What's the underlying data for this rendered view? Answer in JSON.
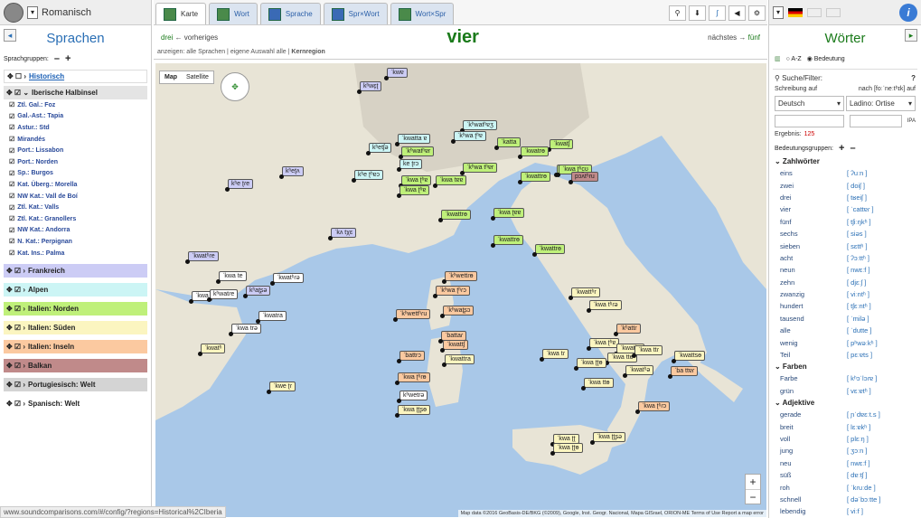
{
  "left_panel": {
    "app_name": "Romanisch",
    "title": "Sprachen",
    "groups_label": "Sprachgruppen:",
    "groups": [
      {
        "label": "Historisch",
        "color": "#ffffff",
        "expanded": false
      },
      {
        "label": "Iberische Halbinsel",
        "color": "#e4e4e4",
        "expanded": true
      }
    ],
    "iberian_languages": [
      "Ztl. Gal.: Foz",
      "Gal.-Ast.: Tapia",
      "Astur.: Std",
      "Mirandés",
      "Port.: Lissabon",
      "Port.: Norden",
      "Sp.: Burgos",
      "Kat. Überg.: Morella",
      "NW Kat.: Vall de Boí",
      "Ztl. Kat.: Valls",
      "Ztl. Kat.: Granollers",
      "NW Kat.: Andorra",
      "N. Kat.: Perpignan",
      "Kat. Ins.: Palma"
    ],
    "other_groups": [
      {
        "label": "Frankreich",
        "color": "#ccccf5"
      },
      {
        "label": "Alpen",
        "color": "#ccf5f5"
      },
      {
        "label": "Italien: Norden",
        "color": "#bff07a"
      },
      {
        "label": "Italien: Süden",
        "color": "#fbf5c0"
      },
      {
        "label": "Italien: Inseln",
        "color": "#fbc9a0"
      },
      {
        "label": "Balkan",
        "color": "#c08a8a"
      },
      {
        "label": "Portugiesisch: Welt",
        "color": "#d4d4d4"
      },
      {
        "label": "Spanisch: Welt",
        "color": "#ffffff"
      }
    ]
  },
  "center": {
    "tabs": [
      "Karte",
      "Wort",
      "Sprache",
      "Spr×Wort",
      "Wort×Spr"
    ],
    "prev_word": "drei",
    "prev_label": "vorheriges",
    "current_word": "vier",
    "next_label": "nächstes",
    "next_word": "fünf",
    "show_text": "anzeigen: alle Sprachen | eigene Auswahl    alle | ",
    "show_bold": "Kernregion",
    "map_types": [
      "Map",
      "Satellite"
    ],
    "map_attribution": "Map data ©2016 GeoBasis-DE/BKG (©2009), Google, Inst. Geogr. Nacional, Mapa GISrael, ORION-ME   Terms of Use   Report a map error",
    "map_labels": [
      {
        "text": "ˈkwɐ",
        "bg": "#ccccf5"
      },
      {
        "text": "kʰwɛ̞ʈ",
        "bg": "#ccccf5"
      },
      {
        "text": "ˈkʰwatʰɐʒ",
        "bg": "#ccf5f5"
      },
      {
        "text": "ˈkʰwa ʈʰɐ",
        "bg": "#ccf5f5"
      },
      {
        "text": "ˈkwatta ɐ",
        "bg": "#ccf5f5"
      },
      {
        "text": "ˈkʰwatʰɐr",
        "bg": "#bff07a"
      },
      {
        "text": "ˈkatta",
        "bg": "#bff07a"
      },
      {
        "text": "kʰetʃə",
        "bg": "#ccf5f5"
      },
      {
        "text": "ˈkwatʃ",
        "bg": "#bff07a"
      },
      {
        "text": "ˈkwatrɵ",
        "bg": "#bff07a"
      },
      {
        "text": "ke ʈrɔ",
        "bg": "#ccf5f5"
      },
      {
        "text": "ˈkʰwa tʰɐr",
        "bg": "#bff07a"
      },
      {
        "text": "kʰeʈʌ",
        "bg": "#ccccf5"
      },
      {
        "text": "kʰe ʈʰɐɔ",
        "bg": "#ccf5f5"
      },
      {
        "text": "ˈkwa ʈʰɐ",
        "bg": "#bff07a"
      },
      {
        "text": "ˈkwa tɐɐ",
        "bg": "#bff07a"
      },
      {
        "text": "kʰe ʈɾe",
        "bg": "#ccccf5"
      },
      {
        "text": "ˈkwa ʈʰɐ",
        "bg": "#bff07a"
      },
      {
        "text": "ˈkwattrɵ",
        "bg": "#bff07a"
      },
      {
        "text": "ˈkwatrɵ",
        "bg": "#bff07a"
      },
      {
        "text": "ˈkwa ʈʰcʊ",
        "bg": "#bff07a"
      },
      {
        "text": "pɔʌ̃tʰɾu",
        "bg": "#c08a8a"
      },
      {
        "text": "ˈkwattrɵ",
        "bg": "#bff07a"
      },
      {
        "text": "ˈkwa ʈɐɐ",
        "bg": "#bff07a"
      },
      {
        "text": "ˈkwattrɵ",
        "bg": "#bff07a"
      },
      {
        "text": "ˈkʌ tχɛ",
        "bg": "#ccccf5"
      },
      {
        "text": "ˈkwattrɵ",
        "bg": "#bff07a"
      },
      {
        "text": "ˈkwatʰɾe",
        "bg": "#ccccf5"
      },
      {
        "text": "ˈkwa te",
        "bg": "#ffffff"
      },
      {
        "text": "ˈkwatʰɾə",
        "bg": "#ffffff"
      },
      {
        "text": "ˈkwa",
        "bg": "#ffffff"
      },
      {
        "text": "kʰwatɾe",
        "bg": "#ffffff"
      },
      {
        "text": "kʰaʈʂə",
        "bg": "#ccccf5"
      },
      {
        "text": "ˈkʰwettɾɵ",
        "bg": "#fbc9a0"
      },
      {
        "text": "ˈkʰwa ʈʰɾɔ",
        "bg": "#fbc9a0"
      },
      {
        "text": "ˈkʰwettʰɾu",
        "bg": "#fbc9a0"
      },
      {
        "text": "ˈkʰwaʈʂɔ",
        "bg": "#fbc9a0"
      },
      {
        "text": "ˈkwattʰr",
        "bg": "#fbf5c0"
      },
      {
        "text": "ˈkwa tʰɾə",
        "bg": "#fbf5c0"
      },
      {
        "text": "ˈkwa trə",
        "bg": "#ffffff"
      },
      {
        "text": "ˈkwatra",
        "bg": "#ffffff"
      },
      {
        "text": "ˈkwatʰ",
        "bg": "#fbf5c0"
      },
      {
        "text": "ˈkʰattɾ",
        "bg": "#fbc9a0"
      },
      {
        "text": "ˈbattaɾ",
        "bg": "#fbc9a0"
      },
      {
        "text": "ˈkwattʃ",
        "bg": "#fbc9a0"
      },
      {
        "text": "ˈbattrɔ",
        "bg": "#fbc9a0"
      },
      {
        "text": "ˈkwattra",
        "bg": "#fbf5c0"
      },
      {
        "text": "ˈkwa tɾ",
        "bg": "#fbf5c0"
      },
      {
        "text": "ˈkwa ʈʰɐ",
        "bg": "#fbf5c0"
      },
      {
        "text": "ˈkwatʰə",
        "bg": "#fbf5c0"
      },
      {
        "text": "ˈkwa ttɵ",
        "bg": "#fbf5c0"
      },
      {
        "text": "ˈkwa ʈʈɵ",
        "bg": "#fbf5c0"
      },
      {
        "text": "ˈkwatʰə",
        "bg": "#fbf5c0"
      },
      {
        "text": "ˈkwa ttɵ",
        "bg": "#fbf5c0"
      },
      {
        "text": "ˈkwa ttɾ",
        "bg": "#fbf5c0"
      },
      {
        "text": "ˈkwattsɵ",
        "bg": "#fbf5c0"
      },
      {
        "text": "ˈba ttɐɾ",
        "bg": "#fbc9a0"
      },
      {
        "text": "ˈkwa ʈʰɾɔ",
        "bg": "#fbc9a0"
      },
      {
        "text": "ˈkwa ʈʰɾɵ",
        "bg": "#fbc9a0"
      },
      {
        "text": "kʰwetrə",
        "bg": "#ffffff"
      },
      {
        "text": "ˈkwa ʈʈʂɵ",
        "bg": "#fbf5c0"
      },
      {
        "text": "ˈkwe ʈɾ",
        "bg": "#fbf5c0"
      },
      {
        "text": "ˈkwa ʈʈ",
        "bg": "#fbf5c0"
      },
      {
        "text": "ˈkwa ʈʈɵ",
        "bg": "#fbf5c0"
      },
      {
        "text": "ˈkwa ʈʈʂə",
        "bg": "#fbf5c0"
      }
    ]
  },
  "status_url": "www.soundcomparisons.com/#/config/?regions=Historical%2CIberia",
  "right_panel": {
    "title": "Wörter",
    "sort_az": "A-Z",
    "sort_meaning": "Bedeutung",
    "search_label": "Suche/Filter:",
    "script_label": "Schreibung auf",
    "phon_label": "nach [foːˈneːtʰɪk] auf",
    "lang_select": "Deutsch",
    "ladino_select": "Ladino: Ortise",
    "ipa_label": "IPA",
    "result_label": "Ergebnis:",
    "result_count": "125",
    "groups_label": "Bedeutungsgruppen:",
    "categories": [
      {
        "name": "Zahlwörter",
        "words": [
          {
            "w": "eins",
            "p": "[ ʔuːn ]"
          },
          {
            "w": "zwei",
            "p": "[ doiʃ ]"
          },
          {
            "w": "drei",
            "p": "[ tʁeiʃ ]"
          },
          {
            "w": "vier",
            "p": "[ ˈcattɐɾ ]"
          },
          {
            "w": "fünf",
            "p": "[ tʃiːŋkʰ ]"
          },
          {
            "w": "sechs",
            "p": "[ siəs ]"
          },
          {
            "w": "sieben",
            "p": "[ sɛttʰ ]"
          },
          {
            "w": "acht",
            "p": "[ ʔɔːttʰ ]"
          },
          {
            "w": "neun",
            "p": "[ nwɛːf ]"
          },
          {
            "w": "zehn",
            "p": "[ djɛːʃ ]"
          },
          {
            "w": "zwanzig",
            "p": "[ viːntʰ ]"
          },
          {
            "w": "hundert",
            "p": "[ tʃɛːntʰ ]"
          },
          {
            "w": "tausend",
            "p": "[ ˈmilə ]"
          },
          {
            "w": "alle",
            "p": "[ ˈdutte ]"
          },
          {
            "w": "wenig",
            "p": "[ pʰwəːkʰ ]"
          },
          {
            "w": "Teil",
            "p": "[ pɛːɐts ]"
          }
        ]
      },
      {
        "name": "Farben",
        "words": [
          {
            "w": "Farbe",
            "p": "[ kʰɔˈlɔɾɐ ]"
          },
          {
            "w": "grün",
            "p": "[ vɛːɐtʰ ]"
          }
        ]
      },
      {
        "name": "Adjektive",
        "words": [
          {
            "w": "gerade",
            "p": "[ ɲˈdɐɛːt.s ]"
          },
          {
            "w": "breit",
            "p": "[ lɛːɐkʰ ]"
          },
          {
            "w": "voll",
            "p": "[ plɛːŋ ]"
          },
          {
            "w": "jung",
            "p": "[ ʒɔːn ]"
          },
          {
            "w": "neu",
            "p": "[ nwɛːf ]"
          },
          {
            "w": "süß",
            "p": "[ dɐːtʃ ]"
          },
          {
            "w": "roh",
            "p": "[ ˈkɾuːde ]"
          },
          {
            "w": "schnell",
            "p": "[ dəˈbɔːtte ]"
          },
          {
            "w": "lebendig",
            "p": "[ viːf ]"
          }
        ]
      }
    ]
  }
}
